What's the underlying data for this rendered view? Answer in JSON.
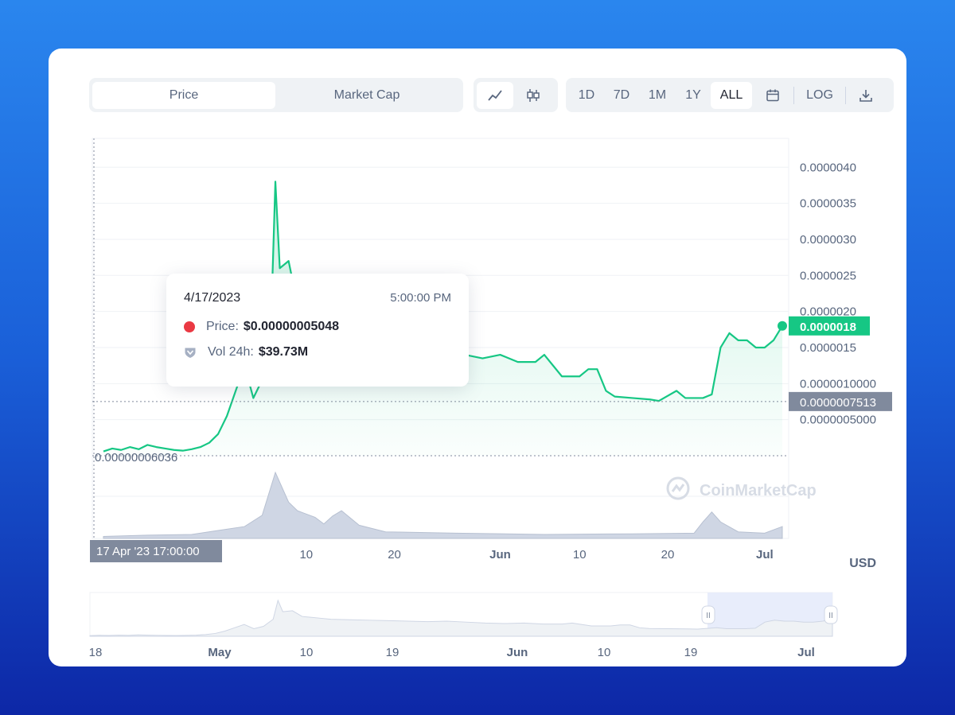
{
  "tabs": {
    "price": "Price",
    "market_cap": "Market Cap"
  },
  "chart_type_icons": [
    "line-chart-icon",
    "candlestick-icon"
  ],
  "ranges": [
    "1D",
    "7D",
    "1M",
    "1Y",
    "ALL"
  ],
  "active_range": "ALL",
  "calendar_icon": "calendar-icon",
  "log_label": "LOG",
  "download_icon": "download-icon",
  "currency": "USD",
  "watermark": "CoinMarketCap",
  "colors": {
    "line": "#16c784",
    "axis_label_bg": "#808a9d",
    "tooltip_dot": "#ea3943",
    "brand": "#1a5fd8"
  },
  "tooltip": {
    "date": "4/17/2023",
    "time": "5:00:00 PM",
    "price_label": "Price:",
    "price_value": "$0.00000005048",
    "vol_label": "Vol 24h:",
    "vol_value": "$39.73M"
  },
  "crosshair_labels": {
    "x": "17 Apr '23   17:00:00",
    "y": "0.0000007513",
    "min": "0.00000006036",
    "current": "0.0000018"
  },
  "chart_data": {
    "type": "line",
    "y_ticks": [
      "0.0000005000",
      "0.0000010000",
      "0.0000015",
      "0.0000020",
      "0.0000025",
      "0.0000030",
      "0.0000035",
      "0.0000040"
    ],
    "y_tick_values": [
      5e-07,
      1e-06,
      1.5e-06,
      2e-06,
      2.5e-06,
      3e-06,
      3.5e-06,
      4e-06
    ],
    "ylim": [
      0,
      4.4e-06
    ],
    "x_ticks": [
      "10",
      "20",
      "Jun",
      "10",
      "20",
      "Jul"
    ],
    "x_tick_day": [
      23,
      33,
      45,
      54,
      64,
      75
    ],
    "xlim_days": [
      0,
      77
    ],
    "price_points": [
      [
        0,
        6e-08
      ],
      [
        1,
        1e-07
      ],
      [
        2,
        8e-08
      ],
      [
        3,
        1.2e-07
      ],
      [
        4,
        9e-08
      ],
      [
        5,
        1.5e-07
      ],
      [
        6,
        1.2e-07
      ],
      [
        7,
        1e-07
      ],
      [
        8,
        8e-08
      ],
      [
        9,
        7e-08
      ],
      [
        10,
        9e-08
      ],
      [
        11,
        1.2e-07
      ],
      [
        12,
        1.8e-07
      ],
      [
        13,
        3e-07
      ],
      [
        14,
        5.5e-07
      ],
      [
        15,
        9e-07
      ],
      [
        16,
        1.25e-06
      ],
      [
        17,
        8e-07
      ],
      [
        18,
        1.05e-06
      ],
      [
        19,
        1.8e-06
      ],
      [
        19.5,
        3.8e-06
      ],
      [
        20,
        2.6e-06
      ],
      [
        21,
        2.7e-06
      ],
      [
        22,
        2.1e-06
      ],
      [
        23,
        2e-06
      ],
      [
        24,
        1.9e-06
      ],
      [
        25,
        1.8e-06
      ],
      [
        27,
        1.75e-06
      ],
      [
        29,
        1.7e-06
      ],
      [
        31,
        1.65e-06
      ],
      [
        33,
        1.6e-06
      ],
      [
        35,
        1.55e-06
      ],
      [
        37,
        1.6e-06
      ],
      [
        39,
        1.5e-06
      ],
      [
        41,
        1.4e-06
      ],
      [
        43,
        1.35e-06
      ],
      [
        45,
        1.4e-06
      ],
      [
        47,
        1.3e-06
      ],
      [
        49,
        1.3e-06
      ],
      [
        50,
        1.4e-06
      ],
      [
        52,
        1.1e-06
      ],
      [
        54,
        1.1e-06
      ],
      [
        55,
        1.2e-06
      ],
      [
        56,
        1.2e-06
      ],
      [
        57,
        9e-07
      ],
      [
        58,
        8.2e-07
      ],
      [
        60,
        8e-07
      ],
      [
        62,
        7.8e-07
      ],
      [
        63,
        7.6e-07
      ],
      [
        65,
        9e-07
      ],
      [
        66,
        8e-07
      ],
      [
        68,
        8e-07
      ],
      [
        69,
        8.5e-07
      ],
      [
        70,
        1.5e-06
      ],
      [
        71,
        1.7e-06
      ],
      [
        72,
        1.6e-06
      ],
      [
        73,
        1.6e-06
      ],
      [
        74,
        1.5e-06
      ],
      [
        75,
        1.5e-06
      ],
      [
        76,
        1.6e-06
      ],
      [
        77,
        1.8e-06
      ]
    ],
    "volume_points": [
      [
        0,
        0.03
      ],
      [
        5,
        0.05
      ],
      [
        10,
        0.06
      ],
      [
        13,
        0.12
      ],
      [
        16,
        0.18
      ],
      [
        18,
        0.35
      ],
      [
        19.5,
        1.0
      ],
      [
        21,
        0.55
      ],
      [
        22,
        0.42
      ],
      [
        24,
        0.32
      ],
      [
        25,
        0.22
      ],
      [
        26,
        0.34
      ],
      [
        27,
        0.42
      ],
      [
        29,
        0.2
      ],
      [
        32,
        0.1
      ],
      [
        40,
        0.08
      ],
      [
        50,
        0.06
      ],
      [
        60,
        0.07
      ],
      [
        67,
        0.08
      ],
      [
        68,
        0.25
      ],
      [
        69,
        0.4
      ],
      [
        70,
        0.25
      ],
      [
        72,
        0.1
      ],
      [
        75,
        0.08
      ],
      [
        77,
        0.18
      ]
    ],
    "navigator_ticks": [
      "18",
      "May",
      "10",
      "19",
      "Jun",
      "10",
      "19",
      "Jul"
    ]
  }
}
